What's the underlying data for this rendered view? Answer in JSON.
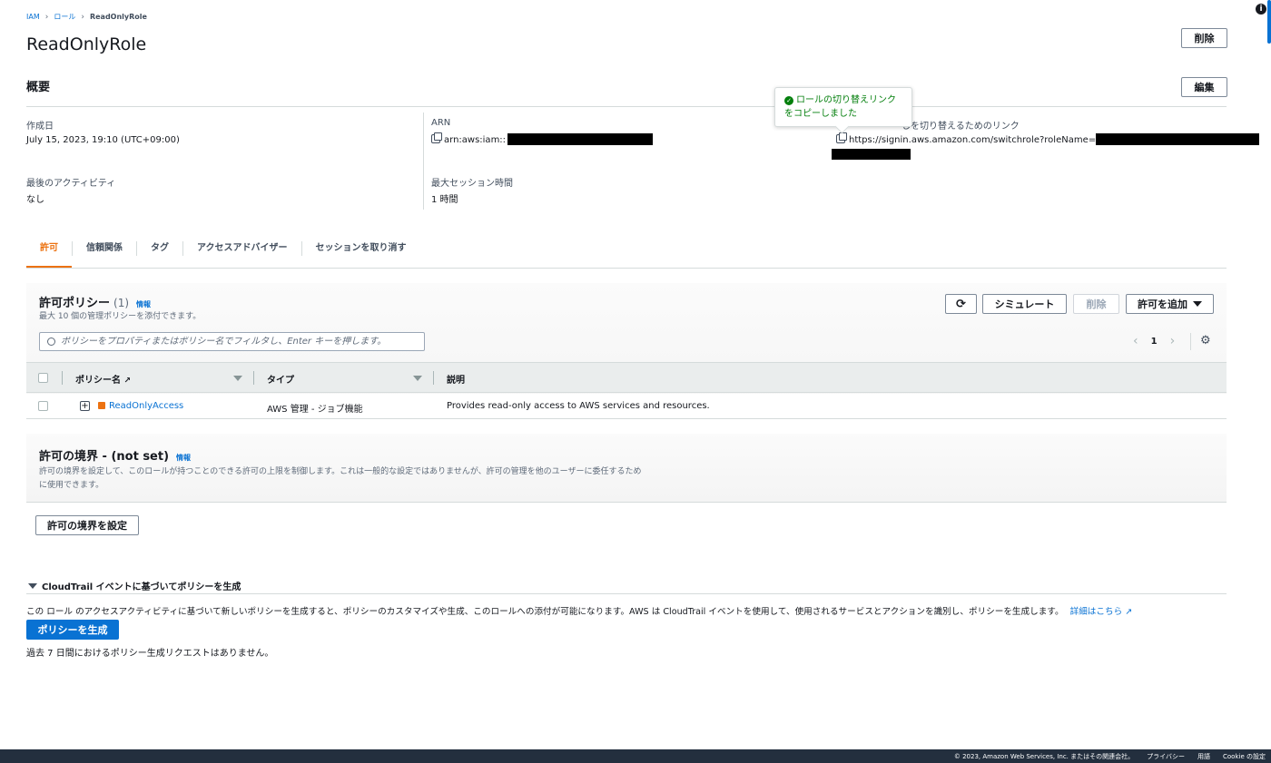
{
  "breadcrumb": {
    "items": [
      "IAM",
      "ロール"
    ],
    "current": "ReadOnlyRole"
  },
  "page": {
    "title": "ReadOnlyRole",
    "delete_label": "削除"
  },
  "summary": {
    "heading": "概要",
    "edit_label": "編集",
    "created_label": "作成日",
    "created_value": "July 15, 2023, 19:10 (UTC+09:00)",
    "last_activity_label": "最後のアクティビティ",
    "last_activity_value": "なし",
    "arn_label": "ARN",
    "arn_value": "arn:aws:iam::",
    "max_session_label": "最大セッション時間",
    "max_session_value": "1 時間",
    "switch_link_label": "しを切り替えるためのリンク",
    "switch_link_value": "https://signin.aws.amazon.com/switchrole?roleName="
  },
  "toast": {
    "line1": "ロールの切り替えリンク",
    "line2": "をコピーしました"
  },
  "tabs": [
    {
      "label": "許可"
    },
    {
      "label": "信頼関係"
    },
    {
      "label": "タグ"
    },
    {
      "label": "アクセスアドバイザー"
    },
    {
      "label": "セッションを取り消す"
    }
  ],
  "permissions": {
    "title": "許可ポリシー",
    "count": "(1)",
    "info": "情報",
    "subtitle": "最大 10 個の管理ポリシーを添付できます。",
    "refresh_icon": "refresh-icon",
    "simulate_label": "シミュレート",
    "delete_label": "削除",
    "add_label": "許可を追加",
    "search_placeholder": "ポリシーをプロパティまたはポリシー名でフィルタし、Enter キーを押します。",
    "page_number": "1",
    "columns": [
      "ポリシー名",
      "タイプ",
      "説明"
    ],
    "rows": [
      {
        "name": "ReadOnlyAccess",
        "type": "AWS 管理 - ジョブ機能",
        "description": "Provides read-only access to AWS services and resources."
      }
    ]
  },
  "boundary": {
    "title": "許可の境界 - (not set)",
    "info": "情報",
    "description_1": "許可の境界を設定して、このロールが持つことのできる許可の上限を制御します。これは一般的な設定ではありませんが、許可の管理を他のユーザーに委任するため",
    "description_2": "に使用できます。",
    "set_label": "許可の境界を設定"
  },
  "cloudtrail": {
    "heading": "CloudTrail イベントに基づいてポリシーを生成",
    "description": "この ロール のアクセスアクティビティに基づいて新しいポリシーを生成すると、ポリシーのカスタマイズや生成、このロールへの添付が可能になります。AWS は CloudTrail イベントを使用して、使用されるサービスとアクションを識別し、ポリシーを生成します。",
    "learn_more": "詳細はこちら",
    "generate_label": "ポリシーを生成",
    "no_requests": "過去 7 日間におけるポリシー生成リクエストはありません。"
  },
  "footer": {
    "copyright": "© 2023, Amazon Web Services, Inc. またはその関連会社。",
    "privacy": "プライバシー",
    "terms": "用語",
    "cookie": "Cookie の設定"
  }
}
